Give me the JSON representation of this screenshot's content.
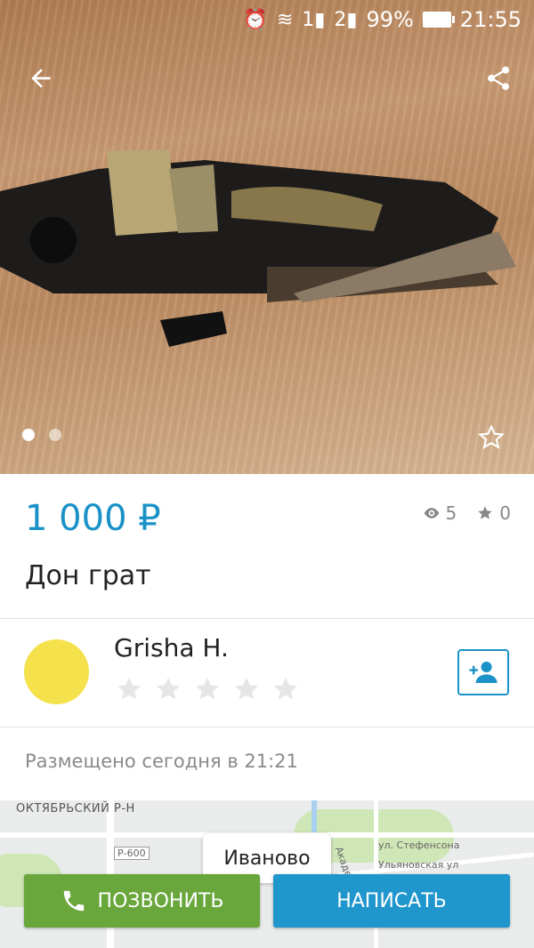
{
  "status_bar": {
    "signal_1": "1",
    "signal_2": "2",
    "battery": "99%",
    "time": "21:55"
  },
  "gallery": {
    "page_count": 2,
    "current_page": 1
  },
  "listing": {
    "price": "1 000 ₽",
    "views": "5",
    "favorites": "0",
    "title": "Дон грат",
    "posted": "Размещено сегодня в 21:21"
  },
  "seller": {
    "name": "Grisha H.",
    "rating": 0,
    "rating_max": 5,
    "avatar_color": "#f5e14c"
  },
  "map": {
    "district": "ОКТЯБРЬСКИЙ Р-Н",
    "city": "Иваново",
    "road_label": "Р-600",
    "street_1": "ул. Стефенсона",
    "street_2": "Ульяновская ул",
    "street_3": "Академическая"
  },
  "actions": {
    "call_label": "ПОЗВОНИТЬ",
    "write_label": "НАПИСАТЬ"
  },
  "colors": {
    "accent": "#1a92c7",
    "call": "#69a63c",
    "write": "#1f96cc"
  }
}
